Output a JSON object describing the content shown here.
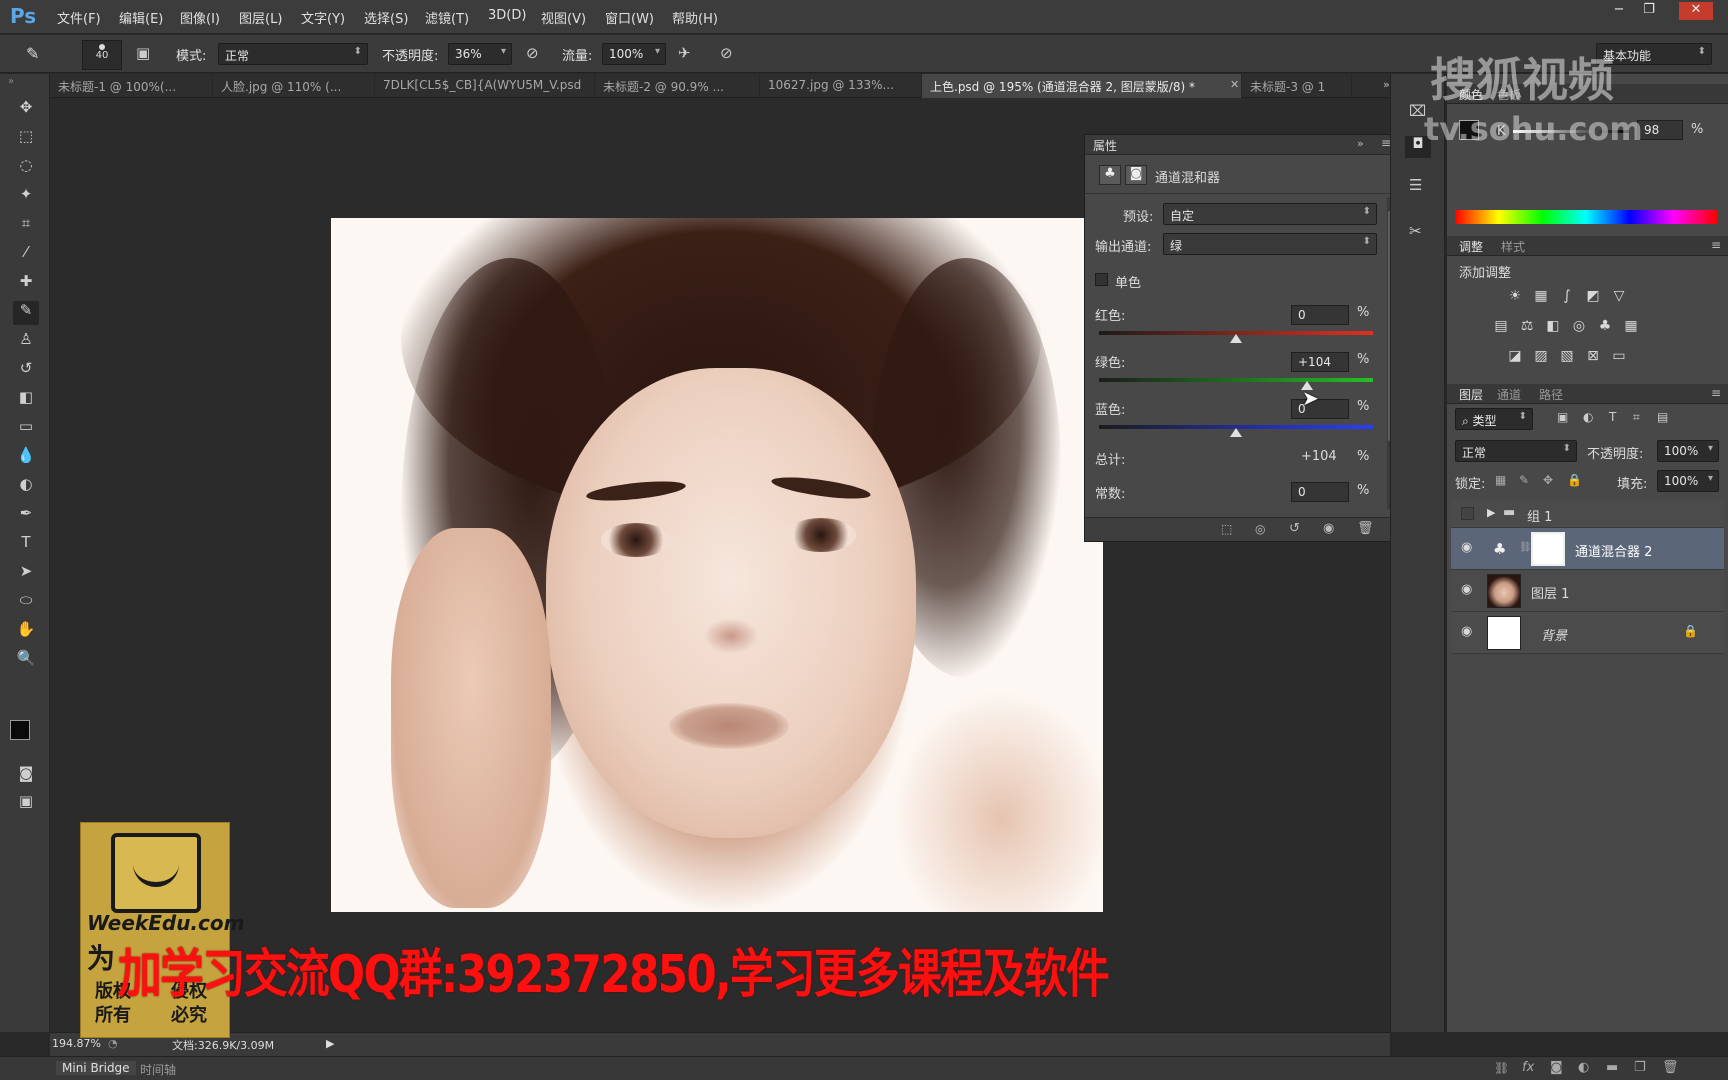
{
  "app": {
    "logo": "Ps"
  },
  "menu": [
    "文件(F)",
    "编辑(E)",
    "图像(I)",
    "图层(L)",
    "文字(Y)",
    "选择(S)",
    "滤镜(T)",
    "3D(D)",
    "视图(V)",
    "窗口(W)",
    "帮助(H)"
  ],
  "window_controls": {
    "minimize": "−",
    "restore": "❐",
    "close": "✕"
  },
  "options": {
    "brush_size": "40",
    "mode_label": "模式:",
    "mode_value": "正常",
    "opacity_label": "不透明度:",
    "opacity_value": "36%",
    "flow_label": "流量:",
    "flow_value": "100%",
    "workspace": "基本功能"
  },
  "tabs": [
    {
      "label": "未标题-1 @ 100%(..."
    },
    {
      "label": "人脸.jpg @ 110% (..."
    },
    {
      "label": "7DLK[CL5$_CB]{A(WYU5M_V.psd"
    },
    {
      "label": "未标题-2 @ 90.9% ..."
    },
    {
      "label": "10627.jpg @ 133%..."
    },
    {
      "label": "上色.psd @ 195% (通道混合器 2, 图层蒙版/8) *"
    },
    {
      "label": "未标题-3 @ 1"
    }
  ],
  "properties": {
    "tab": "属性",
    "title": "通道混和器",
    "preset_label": "预设:",
    "preset_value": "自定",
    "output_label": "输出通道:",
    "output_value": "绿",
    "mono_label": "单色",
    "red_label": "红色:",
    "red_value": "0",
    "green_label": "绿色:",
    "green_value": "+104",
    "blue_label": "蓝色:",
    "blue_value": "0",
    "total_label": "总计:",
    "total_value": "+104",
    "constant_label": "常数:",
    "constant_value": "0",
    "percent": "%",
    "red_level": 0.5,
    "green_level": 0.76,
    "blue_level": 0.5
  },
  "color_panel": {
    "tab1": "颜色",
    "tab2": "色板",
    "k_label": "K",
    "k_value": "98",
    "percent": "%"
  },
  "adjust_panel": {
    "tab1": "调整",
    "tab2": "样式",
    "add_label": "添加调整"
  },
  "layers_panel": {
    "tab1": "图层",
    "tab2": "通道",
    "tab3": "路径",
    "filter": "类型",
    "blend": "正常",
    "opacity_label": "不透明度:",
    "opacity_value": "100%",
    "lock_label": "锁定:",
    "fill_label": "填充:",
    "fill_value": "100%",
    "layers": [
      {
        "name": "组 1"
      },
      {
        "name": "通道混合器 2"
      },
      {
        "name": "图层 1"
      },
      {
        "name": "背景"
      }
    ]
  },
  "status": {
    "zoom": "194.87%",
    "doc": "文档:326.9K/3.09M"
  },
  "bottom": {
    "bridge": "Mini Bridge",
    "timeline": "时间轴"
  },
  "overlay_text": "加学习交流QQ群:392372850,学习更多课程及软件",
  "watermark": {
    "cn": "搜狐视频",
    "url": "tv.sohu.com"
  },
  "logo_box": {
    "brand": "WeekEdu.com",
    "line1": "为",
    "line2a": "版权",
    "line2b": "所有",
    "line3a": "侵权",
    "line3b": "必究"
  }
}
